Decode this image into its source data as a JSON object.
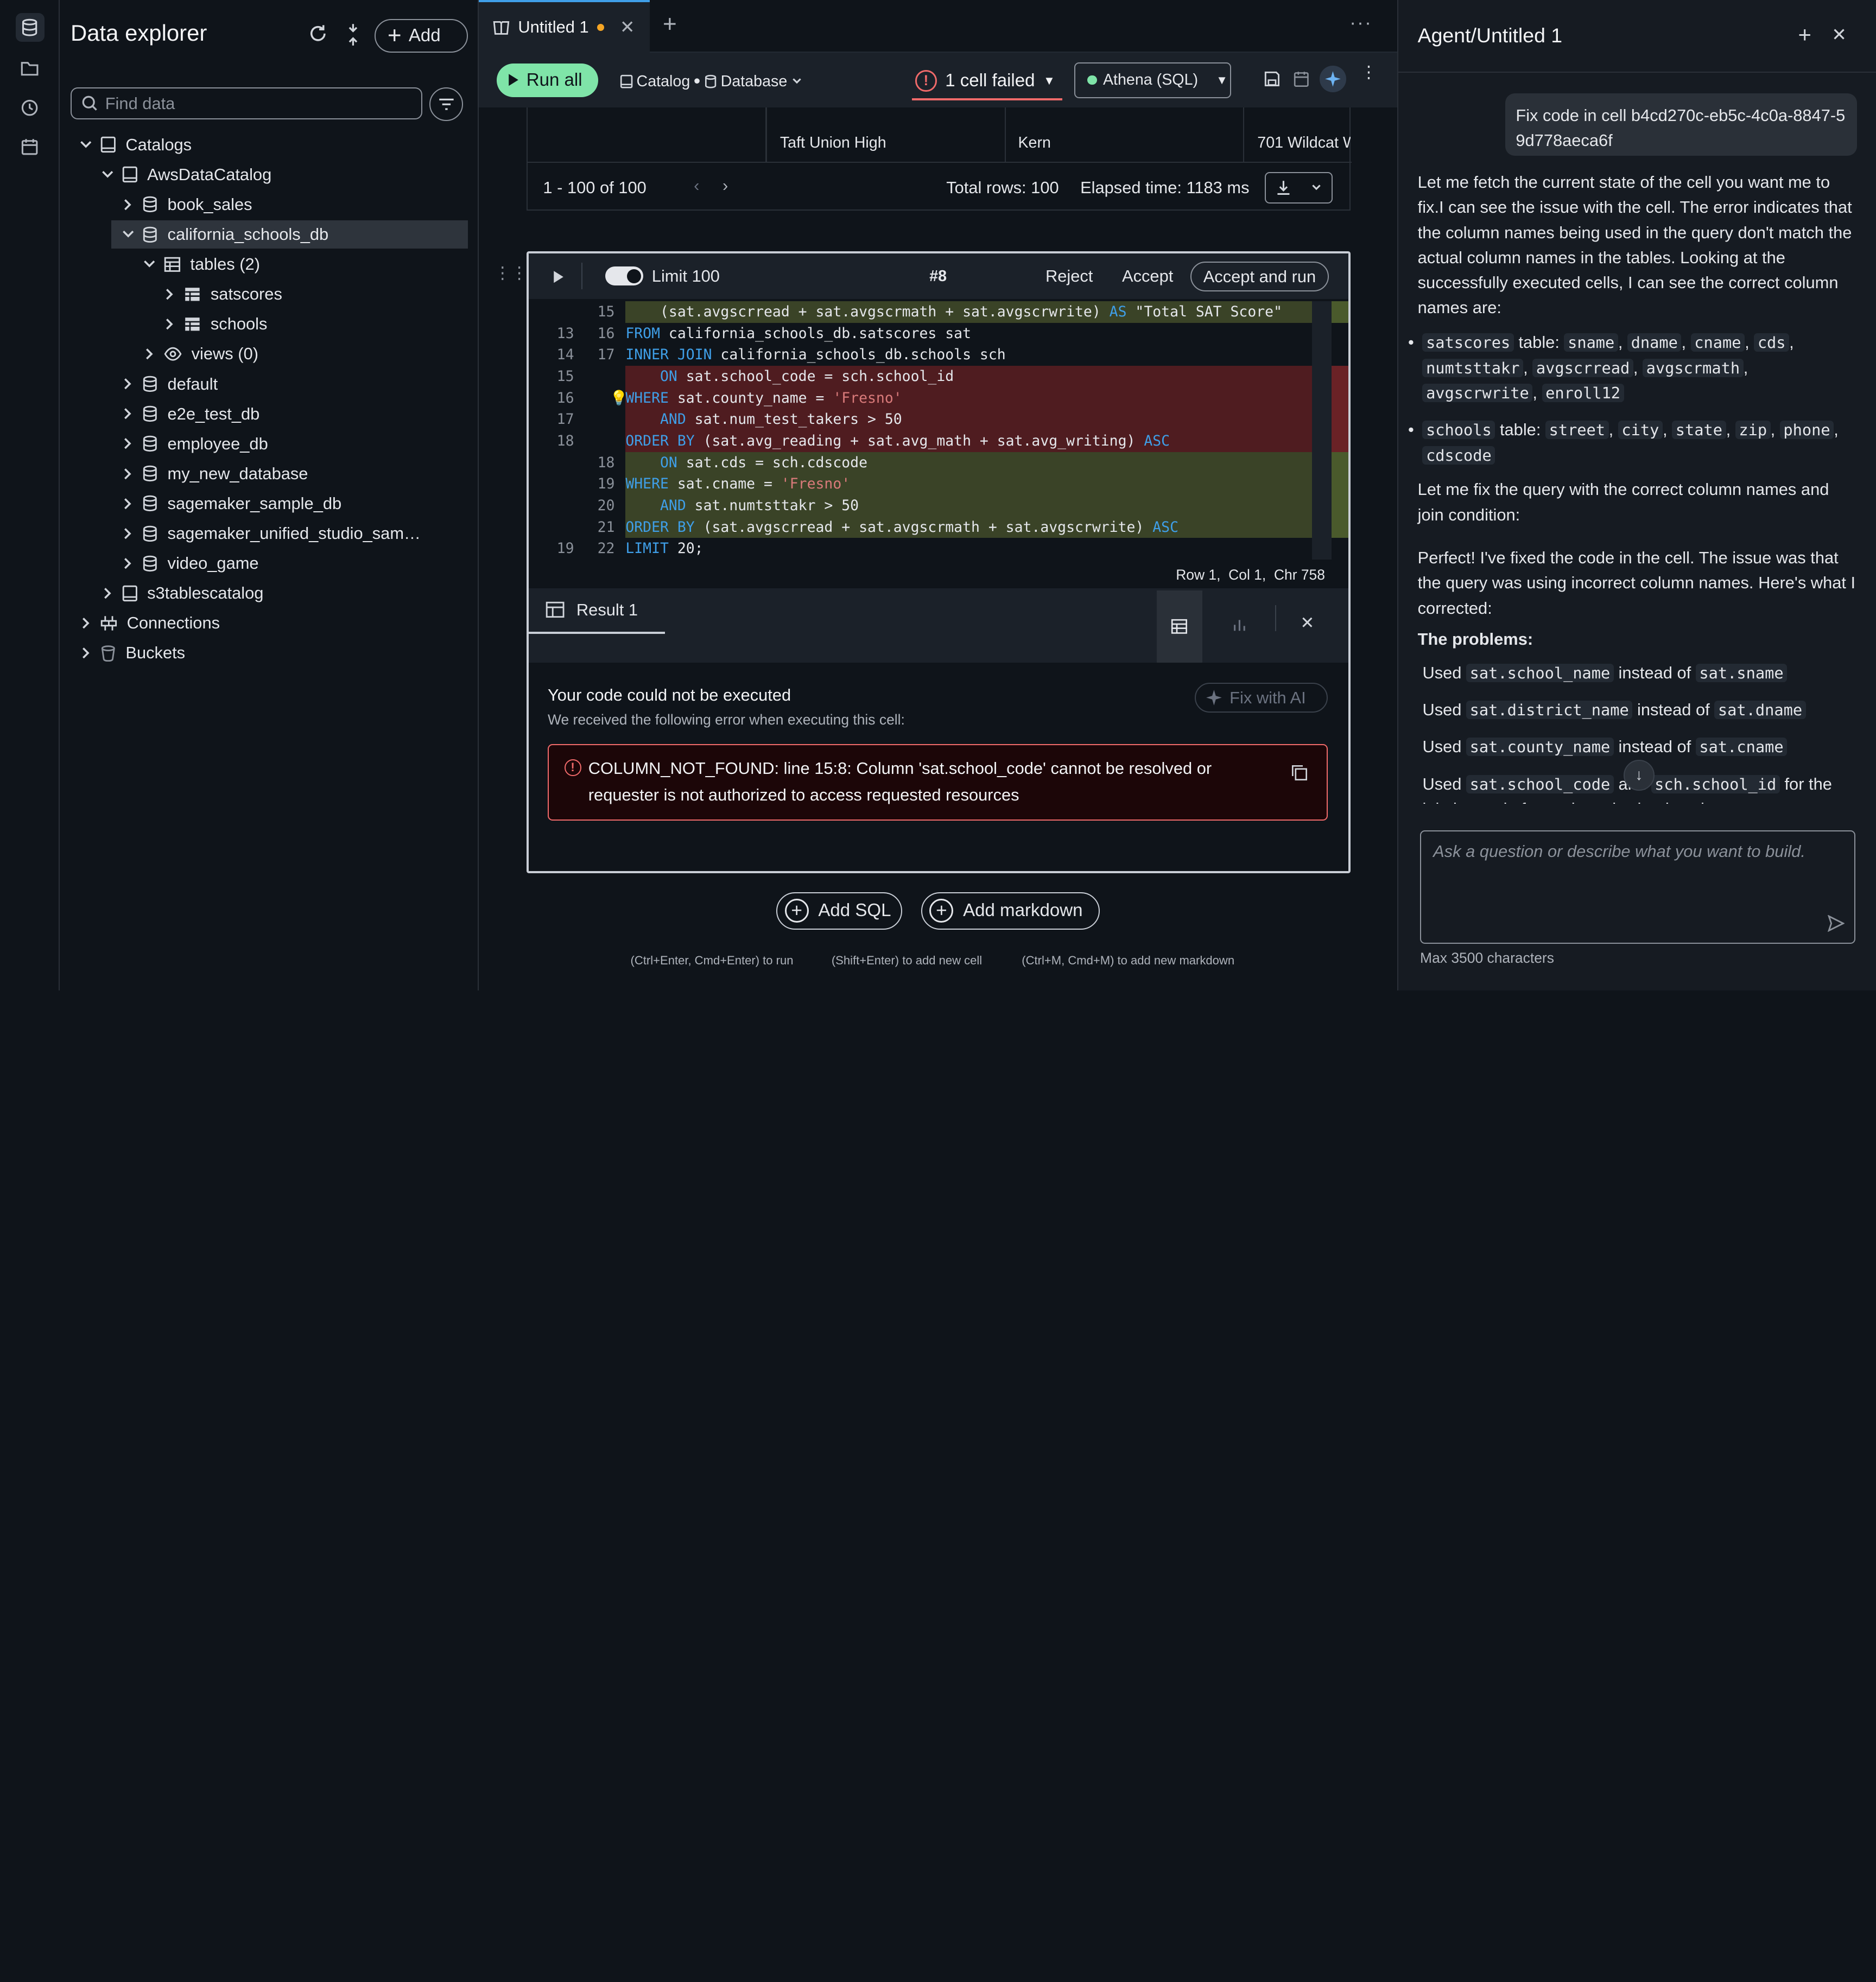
{
  "explorer": {
    "title": "Data explorer",
    "add_label": "Add",
    "search_placeholder": "Find data",
    "tree": [
      {
        "label": "Catalogs",
        "level": 0,
        "icon": "catalog-icon",
        "expanded": true
      },
      {
        "label": "AwsDataCatalog",
        "level": 1,
        "icon": "catalog-icon",
        "expanded": true
      },
      {
        "label": "book_sales",
        "level": 2,
        "icon": "database-icon",
        "expanded": false
      },
      {
        "label": "california_schools_db",
        "level": 2,
        "icon": "database-icon",
        "expanded": true,
        "selected": true
      },
      {
        "label": "tables (2)",
        "level": 3,
        "icon": "table-group-icon",
        "expanded": true
      },
      {
        "label": "satscores",
        "level": 4,
        "icon": "table-icon",
        "expanded": false
      },
      {
        "label": "schools",
        "level": 4,
        "icon": "table-icon",
        "expanded": false
      },
      {
        "label": "views (0)",
        "level": 3,
        "icon": "eye-icon",
        "expanded": false
      },
      {
        "label": "default",
        "level": 2,
        "icon": "database-icon",
        "expanded": false
      },
      {
        "label": "e2e_test_db",
        "level": 2,
        "icon": "database-icon",
        "expanded": false
      },
      {
        "label": "employee_db",
        "level": 2,
        "icon": "database-icon",
        "expanded": false
      },
      {
        "label": "my_new_database",
        "level": 2,
        "icon": "database-icon",
        "expanded": false
      },
      {
        "label": "sagemaker_sample_db",
        "level": 2,
        "icon": "database-icon",
        "expanded": false
      },
      {
        "label": "sagemaker_unified_studio_sam…",
        "level": 2,
        "icon": "database-icon",
        "expanded": false
      },
      {
        "label": "video_game",
        "level": 2,
        "icon": "database-icon",
        "expanded": false
      },
      {
        "label": "s3tablescatalog",
        "level": 1,
        "icon": "catalog-icon",
        "expanded": false
      },
      {
        "label": "Connections",
        "level": 0,
        "icon": "connection-icon",
        "expanded": false
      },
      {
        "label": "Buckets",
        "level": 0,
        "icon": "bucket-icon",
        "expanded": false
      }
    ]
  },
  "tab": {
    "title": "Untitled 1"
  },
  "toolbar": {
    "run_all": "Run all",
    "catalog": "Catalog",
    "database": "Database",
    "status": "1 cell failed",
    "engine": "Athena (SQL)"
  },
  "prev_result": {
    "cells": [
      "Taft Union High",
      "Kern",
      "701 Wildcat W"
    ],
    "pagination": "1 - 100 of 100",
    "total_rows": "Total rows: 100",
    "elapsed": "Elapsed time: 1183 ms"
  },
  "cell": {
    "limit": "Limit 100",
    "number": "#8",
    "reject": "Reject",
    "accept": "Accept",
    "accept_run": "Accept and run",
    "cursor": "Row 1,  Col 1,  Chr 758"
  },
  "code_lines": [
    {
      "old": "",
      "new": "15",
      "type": "add",
      "text": "    (sat.avgscrread + sat.avgscrmath + sat.avgscrwrite) AS \"Total SAT Score\""
    },
    {
      "old": "13",
      "new": "16",
      "type": "ctx",
      "text": "FROM california_schools_db.satscores sat"
    },
    {
      "old": "14",
      "new": "17",
      "type": "ctx",
      "text": "INNER JOIN california_schools_db.schools sch"
    },
    {
      "old": "15",
      "new": "",
      "type": "del",
      "text": "    ON sat.school_code = sch.school_id"
    },
    {
      "old": "16",
      "new": "",
      "type": "del",
      "text": "WHERE sat.county_name = 'Fresno'"
    },
    {
      "old": "17",
      "new": "",
      "type": "del",
      "text": "    AND sat.num_test_takers > 50"
    },
    {
      "old": "18",
      "new": "",
      "type": "del",
      "text": "ORDER BY (sat.avg_reading + sat.avg_math + sat.avg_writing) ASC"
    },
    {
      "old": "",
      "new": "18",
      "type": "add",
      "text": "    ON sat.cds = sch.cdscode"
    },
    {
      "old": "",
      "new": "19",
      "type": "add",
      "text": "WHERE sat.cname = 'Fresno'"
    },
    {
      "old": "",
      "new": "20",
      "type": "add",
      "text": "    AND sat.numtsttakr > 50"
    },
    {
      "old": "",
      "new": "21",
      "type": "add",
      "text": "ORDER BY (sat.avgscrread + sat.avgscrmath + sat.avgscrwrite) ASC"
    },
    {
      "old": "19",
      "new": "22",
      "type": "ctx",
      "text": "LIMIT 20;"
    }
  ],
  "result": {
    "tab": "Result 1",
    "error_title": "Your code could not be executed",
    "error_sub": "We received the following error when executing this cell:",
    "fix_ai": "Fix with AI",
    "error_msg": "COLUMN_NOT_FOUND: line 15:8: Column 'sat.school_code' cannot be resolved or requester is not authorized to access requested resources"
  },
  "add": {
    "sql": "Add SQL",
    "markdown": "Add markdown"
  },
  "hints": [
    "(Ctrl+Enter, Cmd+Enter) to run",
    "(Shift+Enter) to add new cell",
    "(Ctrl+M, Cmd+M) to add new markdown"
  ],
  "agent": {
    "title": "Agent/Untitled 1",
    "user_msg": "Fix code in cell b4cd270c-eb5c-4c0a-8847-59d778aeca6f",
    "p1": "Let me fetch the current state of the cell you want me to fix.I can see the issue with the cell. The error indicates that the column names being used in the query don't match the actual column names in the tables. Looking at the successfully executed cells, I can see the correct column names are:",
    "sat_table": "satscores",
    "sat_label": " table: ",
    "sat_cols": [
      "sname",
      "dname",
      "cname",
      "cds",
      "numtsttakr",
      "avgscrread",
      "avgscrmath",
      "avgscrwrite",
      "enroll12"
    ],
    "sch_table": "schools",
    "sch_label": " table: ",
    "sch_cols": [
      "street",
      "city",
      "state",
      "zip",
      "phone",
      "cdscode"
    ],
    "p2": "Let me fix the query with the correct column names and join condition:",
    "p3": "Perfect! I've fixed the code in the cell. The issue was that the query was using incorrect column names. Here's what I corrected:",
    "problems": "The problems:",
    "fixes": [
      {
        "used": "Used ",
        "wrong": "sat.school_name",
        "mid": " instead of ",
        "right": "sat.sname",
        "tail": ""
      },
      {
        "used": "Used ",
        "wrong": "sat.district_name",
        "mid": " instead of ",
        "right": "sat.dname",
        "tail": ""
      },
      {
        "used": "Used ",
        "wrong": "sat.county_name",
        "mid": " instead of ",
        "right": "sat.cname",
        "tail": ""
      },
      {
        "used": "Used ",
        "wrong": "sat.school_code",
        "mid": " and ",
        "right": "sch.school_id",
        "tail": " for the join instead of sat.cds and sch.cdscode"
      }
    ],
    "input_placeholder": "Ask a question or describe what you want to build.",
    "max_chars": "Max 3500 characters"
  },
  "colors": {
    "accent": "#7fe4a8",
    "error": "#f06a6a",
    "add_bg": "#3b4a2a",
    "del_bg": "#5a1e22",
    "bg": "#0f141a"
  }
}
